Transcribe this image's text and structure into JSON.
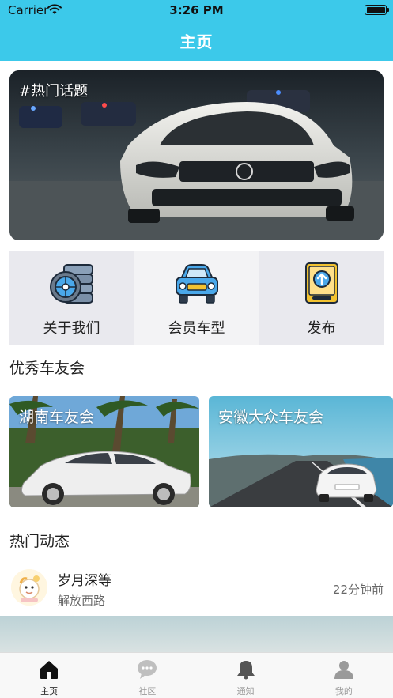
{
  "status_bar": {
    "carrier": "Carrier",
    "time": "3:26 PM"
  },
  "nav": {
    "title": "主页"
  },
  "banner": {
    "caption": "#热门话题"
  },
  "quick_actions": [
    {
      "label": "关于我们",
      "icon": "tire-icon"
    },
    {
      "label": "会员车型",
      "icon": "car-front-icon"
    },
    {
      "label": "发布",
      "icon": "publish-upload-icon"
    }
  ],
  "clubs_section": {
    "title": "优秀车友会"
  },
  "clubs": [
    {
      "name": "湖南车友会"
    },
    {
      "name": "安徽大众车友会"
    }
  ],
  "feed_section": {
    "title": "热门动态"
  },
  "post": {
    "user": "岁月深等",
    "location": "解放西路",
    "time_ago": "22分钟前"
  },
  "tabs": [
    {
      "label": "主页",
      "icon": "home-icon",
      "active": true
    },
    {
      "label": "社区",
      "icon": "chat-bubble-icon",
      "active": false
    },
    {
      "label": "通知",
      "icon": "bell-icon",
      "active": false
    },
    {
      "label": "我的",
      "icon": "user-icon",
      "active": false
    }
  ],
  "colors": {
    "accent": "#3cc9ea",
    "tab_active": "#111111",
    "tab_inactive": "#999999"
  }
}
